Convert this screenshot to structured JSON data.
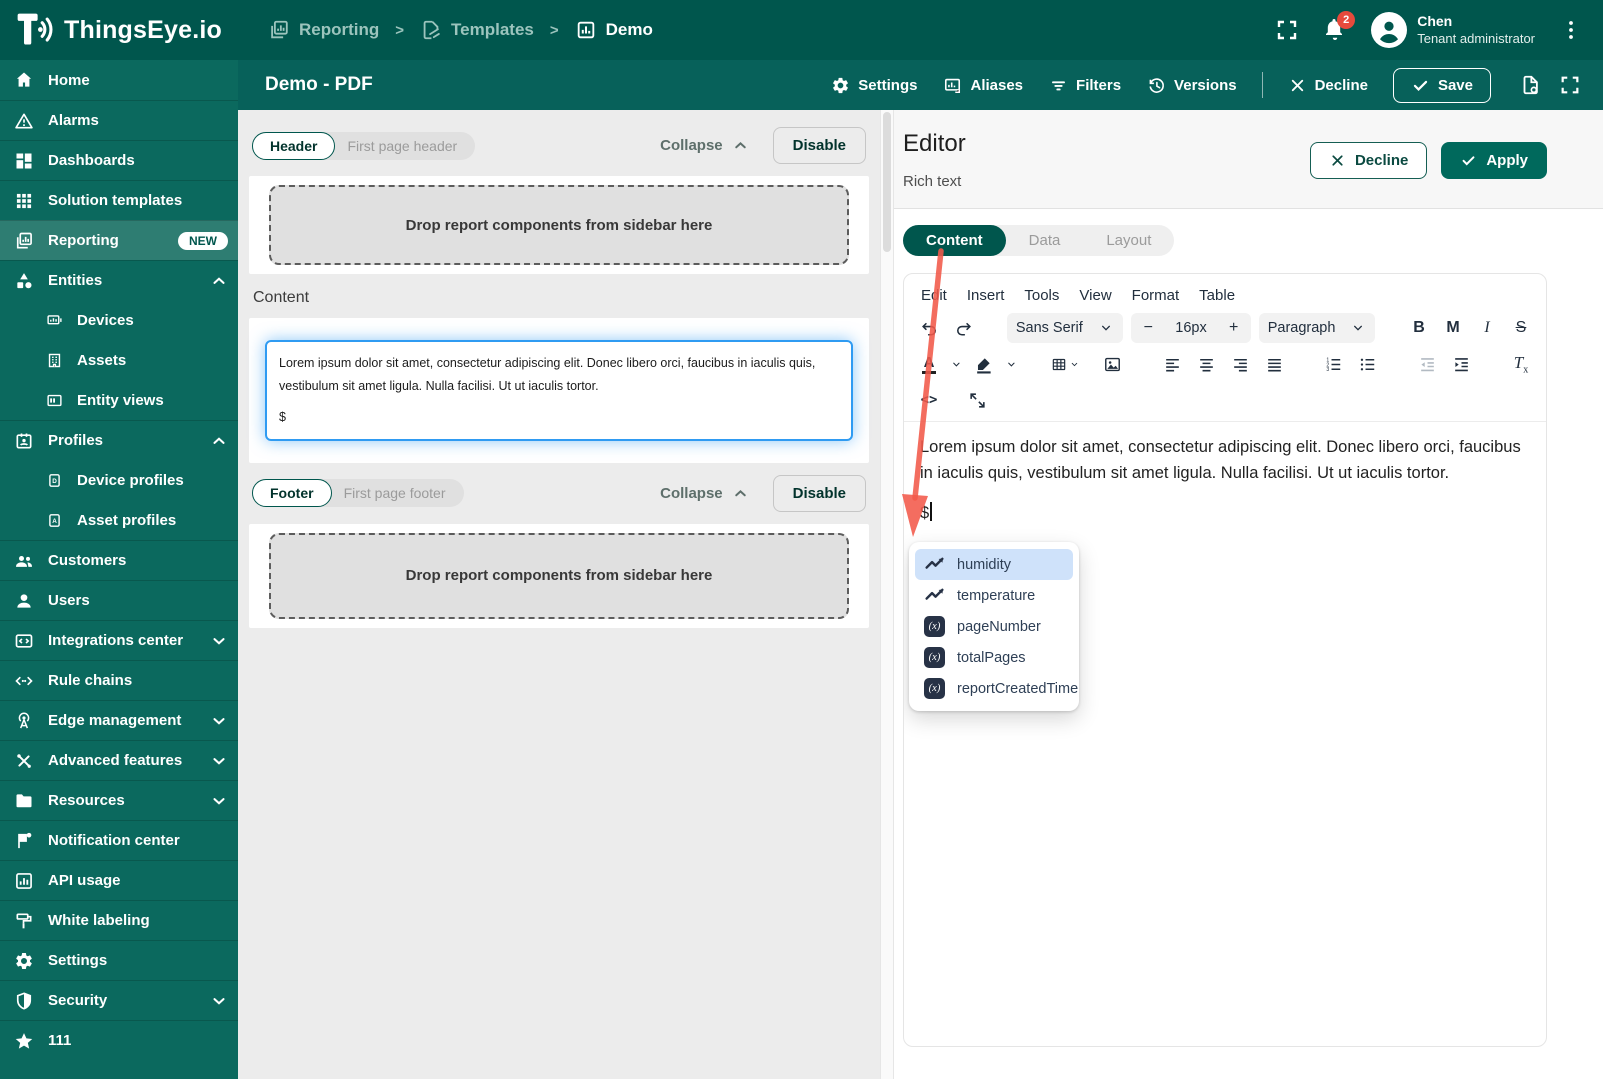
{
  "topbar": {
    "logo_text": "ThingsEye.io",
    "breadcrumb": [
      {
        "label": "Reporting",
        "icon": "reporting-icon"
      },
      {
        "label": "Templates",
        "icon": "templates-icon"
      },
      {
        "label": "Demo",
        "icon": "bar-chart-icon"
      }
    ],
    "breadcrumb_separator": ">",
    "notifications_badge": "2",
    "user": {
      "name": "Chen",
      "role": "Tenant administrator"
    }
  },
  "subheader": {
    "title": "Demo - PDF",
    "settings": "Settings",
    "aliases": "Aliases",
    "filters": "Filters",
    "versions": "Versions",
    "decline": "Decline",
    "save": "Save"
  },
  "sidebar": {
    "items": [
      {
        "label": "Home",
        "icon": "home-icon"
      },
      {
        "label": "Alarms",
        "icon": "warning-icon"
      },
      {
        "label": "Dashboards",
        "icon": "dashboards-icon"
      },
      {
        "label": "Solution templates",
        "icon": "grid-icon"
      },
      {
        "label": "Reporting",
        "icon": "reporting-icon",
        "badge": "NEW",
        "active": true
      },
      {
        "label": "Entities",
        "icon": "entities-icon",
        "expanded": true
      },
      {
        "label": "Devices",
        "icon": "devices-icon",
        "child": true
      },
      {
        "label": "Assets",
        "icon": "assets-icon",
        "child": true
      },
      {
        "label": "Entity views",
        "icon": "entity-views-icon",
        "child": true
      },
      {
        "label": "Profiles",
        "icon": "profiles-icon",
        "expanded": true
      },
      {
        "label": "Device profiles",
        "icon": "device-profile-icon",
        "child": true
      },
      {
        "label": "Asset profiles",
        "icon": "asset-profile-icon",
        "child": true
      },
      {
        "label": "Customers",
        "icon": "customers-icon"
      },
      {
        "label": "Users",
        "icon": "user-icon"
      },
      {
        "label": "Integrations center",
        "icon": "integrations-icon",
        "collapsed": true
      },
      {
        "label": "Rule chains",
        "icon": "rule-chains-icon"
      },
      {
        "label": "Edge management",
        "icon": "edge-icon",
        "collapsed": true
      },
      {
        "label": "Advanced features",
        "icon": "tools-icon",
        "collapsed": true
      },
      {
        "label": "Resources",
        "icon": "folder-icon",
        "collapsed": true
      },
      {
        "label": "Notification center",
        "icon": "flag-icon"
      },
      {
        "label": "API usage",
        "icon": "api-usage-icon"
      },
      {
        "label": "White labeling",
        "icon": "white-label-icon"
      },
      {
        "label": "Settings",
        "icon": "gear-icon"
      },
      {
        "label": "Security",
        "icon": "shield-icon",
        "collapsed": true
      },
      {
        "label": "111",
        "icon": "star-icon"
      }
    ]
  },
  "canvas": {
    "dropzone_text": "Drop report components from sidebar here",
    "collapse_label": "Collapse",
    "disable_label": "Disable",
    "header_section": {
      "chip": "Header",
      "chip_aside": "First page header"
    },
    "content_label": "Content",
    "content_text": "Lorem ipsum dolor sit amet, consectetur adipiscing elit. Donec libero orci, faucibus in iaculis quis, vestibulum sit amet ligula. Nulla facilisi. Ut ut iaculis tortor.",
    "content_trigger": "$",
    "footer_section": {
      "chip": "Footer",
      "chip_aside": "First page footer"
    }
  },
  "editor": {
    "title": "Editor",
    "subtitle": "Rich text",
    "decline_label": "Decline",
    "apply_label": "Apply",
    "tabs": [
      {
        "label": "Content"
      },
      {
        "label": "Data"
      },
      {
        "label": "Layout"
      }
    ],
    "active_tab": "Content",
    "menubar": [
      {
        "label": "Edit"
      },
      {
        "label": "Insert"
      },
      {
        "label": "Tools"
      },
      {
        "label": "View"
      },
      {
        "label": "Format"
      },
      {
        "label": "Table"
      }
    ],
    "toolbar": {
      "font_family": "Sans Serif",
      "font_size": "16px",
      "minus": "−",
      "plus": "+",
      "block_format": "Paragraph",
      "bold": "B",
      "merge_tag": "M",
      "italic": "I",
      "strikethrough": "S",
      "text_color": "A"
    },
    "content_paragraph": "Lorem ipsum dolor sit amet, consectetur adipiscing elit. Donec libero orci, faucibus in iaculis quis, vestibulum sit amet ligula. Nulla facilisi. Ut ut iaculis tortor.",
    "trigger_char": "$",
    "autocomplete": {
      "items": [
        {
          "label": "humidity",
          "icon": "timeseries-icon",
          "selected": true
        },
        {
          "label": "temperature",
          "icon": "timeseries-icon"
        },
        {
          "label": "pageNumber",
          "icon": "variable-icon"
        },
        {
          "label": "totalPages",
          "icon": "variable-icon"
        },
        {
          "label": "reportCreatedTime",
          "icon": "variable-icon"
        }
      ],
      "variable_badge": "(x)"
    }
  },
  "colors": {
    "topbar": "#00564D",
    "sidebar": "#0B695E",
    "sidebar_active": "#2E7D72",
    "accent": "#00695C",
    "selection_blue": "#2F9BF2",
    "badge_red": "#E64A3C",
    "arrow_red": "#F2594A",
    "autocomplete_selected": "#CFE2FA"
  }
}
